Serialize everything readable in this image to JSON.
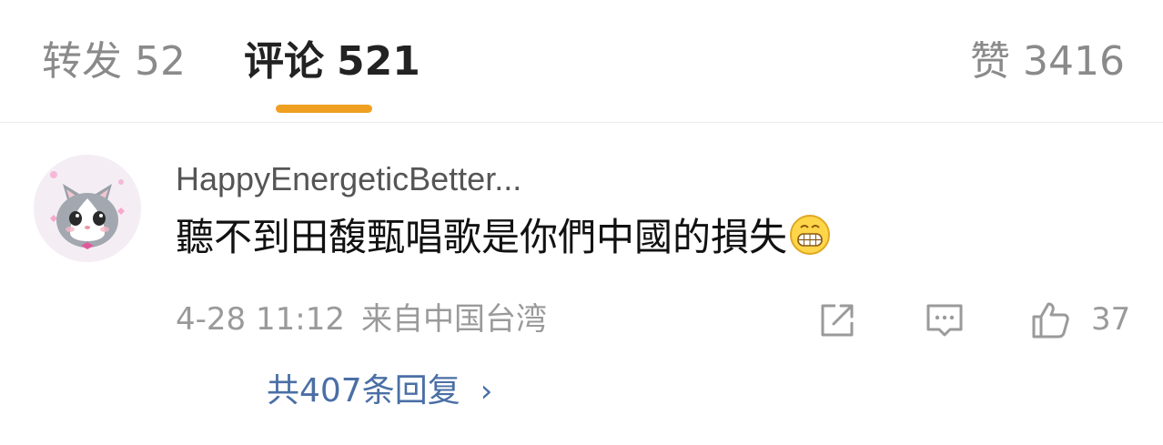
{
  "tabs": {
    "repost": {
      "label": "转发",
      "count": "52"
    },
    "comments": {
      "label": "评论",
      "count": "521"
    },
    "likes": {
      "label": "赞",
      "count": "3416"
    }
  },
  "colors": {
    "accent": "#f0a020",
    "link": "#4a6fa5",
    "muted": "#9a9a9a"
  },
  "comment": {
    "username": "HappyEnergeticBetter...",
    "text": "聽不到田馥甄唱歌是你們中國的損失",
    "emoji": "grin-emoji",
    "time": "4-28 11:12",
    "location": "来自中国台湾",
    "like_count": "37",
    "replies_label": "共407条回复",
    "replies_chevron": "›",
    "icons": [
      "share-icon",
      "comment-icon",
      "like-icon"
    ]
  }
}
